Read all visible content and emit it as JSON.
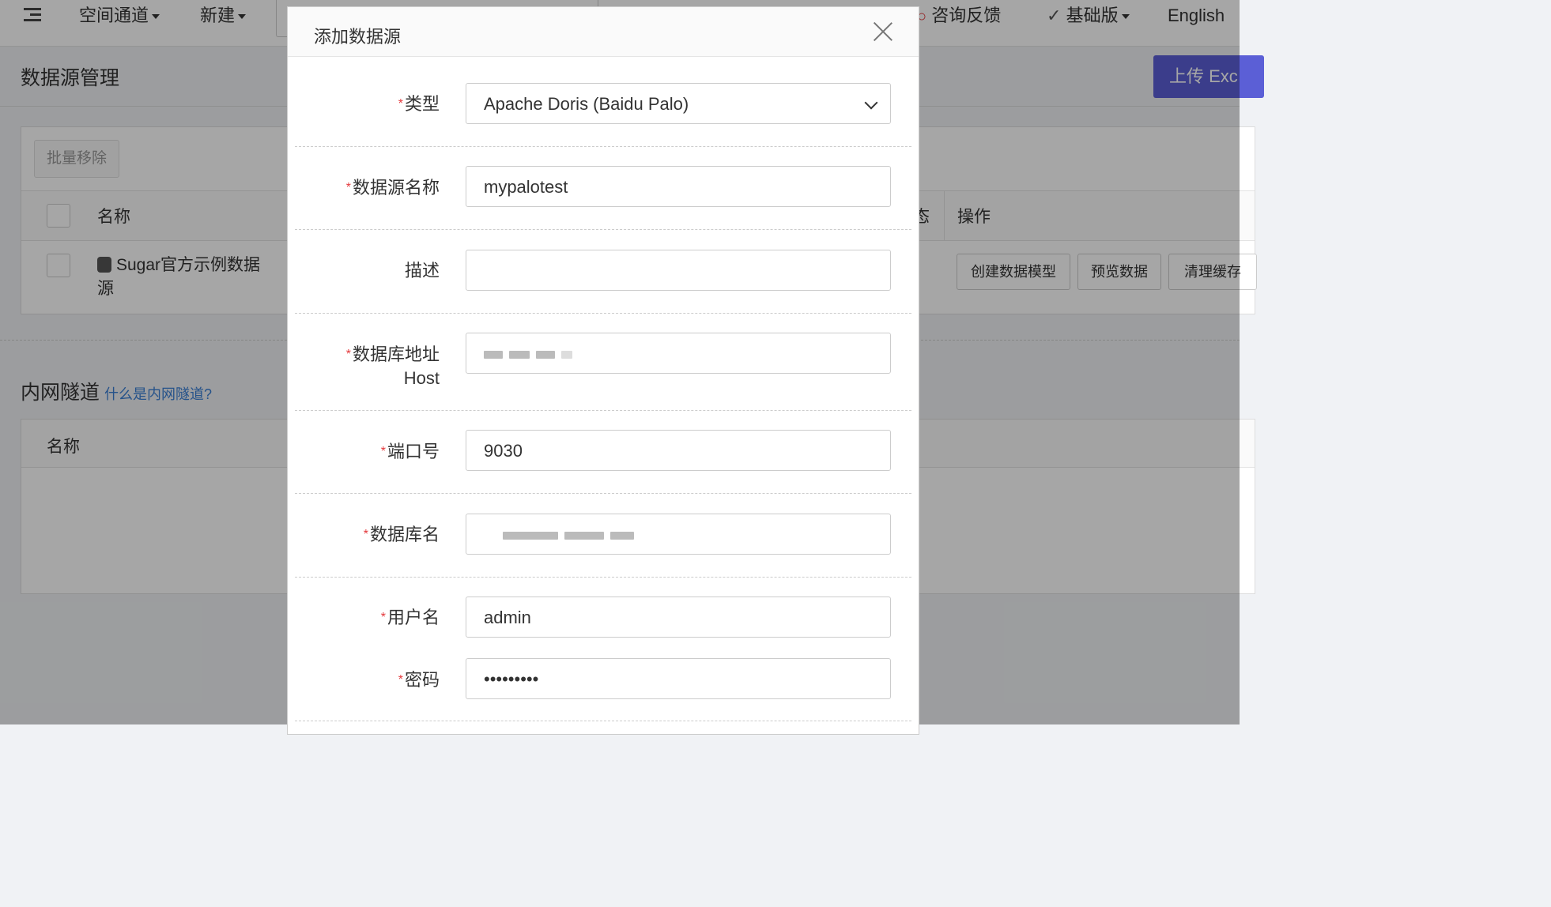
{
  "topnav": {
    "space_channel": "空间通道",
    "new": "新建",
    "feedback": "咨询反馈",
    "edition": "基础版",
    "language": "English"
  },
  "page": {
    "title": "数据源管理",
    "upload_button": "上传 Exc",
    "batch_remove": "批量移除",
    "table": {
      "col_name": "名称",
      "col_status_partial": "态",
      "col_operations": "操作",
      "row_name_line1": "Sugar官方示例数据",
      "row_name_line2": "源",
      "op_create_model": "创建数据模型",
      "op_preview": "预览数据",
      "op_clear_cache": "清理缓存"
    },
    "tunnel": {
      "title": "内网隧道",
      "help_link": "什么是内网隧道?",
      "col_name": "名称"
    }
  },
  "modal": {
    "title": "添加数据源",
    "required_mark": "*",
    "fields": {
      "type": {
        "label": "类型",
        "value": "Apache Doris (Baidu Palo)"
      },
      "name": {
        "label": "数据源名称",
        "value": "mypalotest"
      },
      "description": {
        "label": "描述",
        "value": ""
      },
      "host": {
        "label_line1": "数据库地址",
        "label_line2": "Host"
      },
      "port": {
        "label": "端口号",
        "value": "9030"
      },
      "database": {
        "label": "数据库名"
      },
      "username": {
        "label": "用户名",
        "value": "admin"
      },
      "password": {
        "label": "密码",
        "value": "•••••••••"
      }
    }
  },
  "colors": {
    "accent": "#5b5fd6",
    "link": "#3a7fd5",
    "required": "#e4393c"
  }
}
